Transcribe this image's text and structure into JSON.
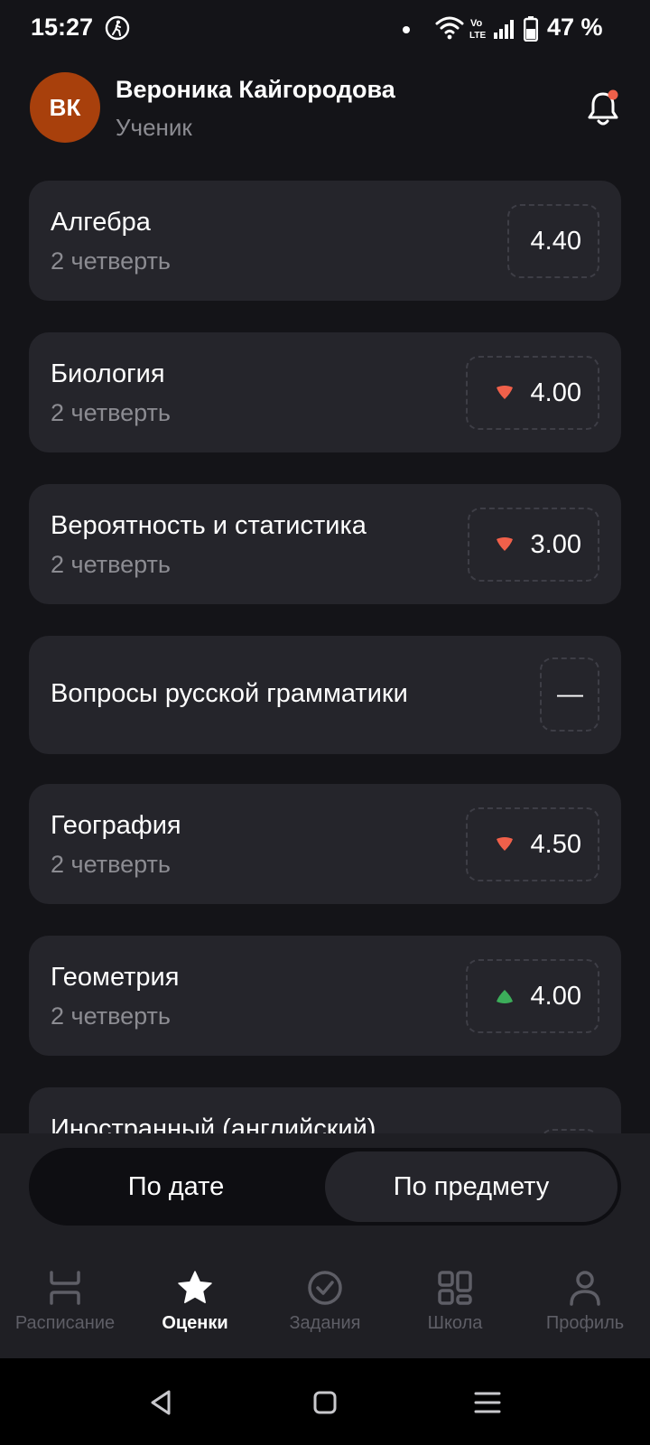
{
  "status_bar": {
    "time": "15:27",
    "battery": "47 %"
  },
  "header": {
    "avatar_initials": "ВК",
    "name": "Вероника Кайгородова",
    "role": "Ученик"
  },
  "subjects": [
    {
      "title": "Алгебра",
      "period": "2 четверть",
      "grade": "4.40",
      "trend": "none"
    },
    {
      "title": "Биология",
      "period": "2 четверть",
      "grade": "4.00",
      "trend": "down"
    },
    {
      "title": "Вероятность и статистика",
      "period": "2 четверть",
      "grade": "3.00",
      "trend": "down"
    },
    {
      "title": "Вопросы русской грамматики",
      "period": "",
      "grade": "—",
      "trend": "none"
    },
    {
      "title": "География",
      "period": "2 четверть",
      "grade": "4.50",
      "trend": "down"
    },
    {
      "title": "Геометрия",
      "period": "2 четверть",
      "grade": "4.00",
      "trend": "up"
    },
    {
      "title": "Иностранный (английский)",
      "period": "",
      "grade": "",
      "trend": "none"
    }
  ],
  "segment": {
    "by_date": "По дате",
    "by_subject": "По предмету",
    "selected": "by_subject"
  },
  "bottom_nav": [
    {
      "label": "Расписание",
      "icon": "schedule-icon",
      "active": false
    },
    {
      "label": "Оценки",
      "icon": "star-icon",
      "active": true
    },
    {
      "label": "Задания",
      "icon": "check-circle-icon",
      "active": false
    },
    {
      "label": "Школа",
      "icon": "grid-icon",
      "active": false
    },
    {
      "label": "Профиль",
      "icon": "person-icon",
      "active": false
    }
  ],
  "colors": {
    "background": "#141418",
    "card": "#25252b",
    "trend_down": "#f0604a",
    "trend_up": "#3cae5a",
    "avatar": "#a8400c",
    "notification_dot": "#f0604a"
  }
}
